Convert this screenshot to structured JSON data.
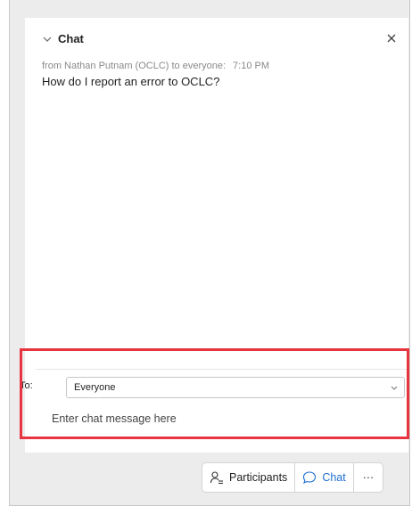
{
  "chat_panel": {
    "title": "Chat",
    "close_glyph": "×",
    "message": {
      "meta": "from Nathan Putnam (OCLC) to everyone:",
      "time": "7:10 PM",
      "text": "How do I report an error to OCLC?"
    },
    "composer": {
      "to_label": "To:",
      "recipient": "Everyone",
      "placeholder": "Enter chat message here"
    }
  },
  "toolbar": {
    "participants_label": "Participants",
    "chat_label": "Chat",
    "more_label": "···"
  },
  "colors": {
    "highlight": "#e8343f",
    "chat_accent": "#1f6fd1"
  }
}
